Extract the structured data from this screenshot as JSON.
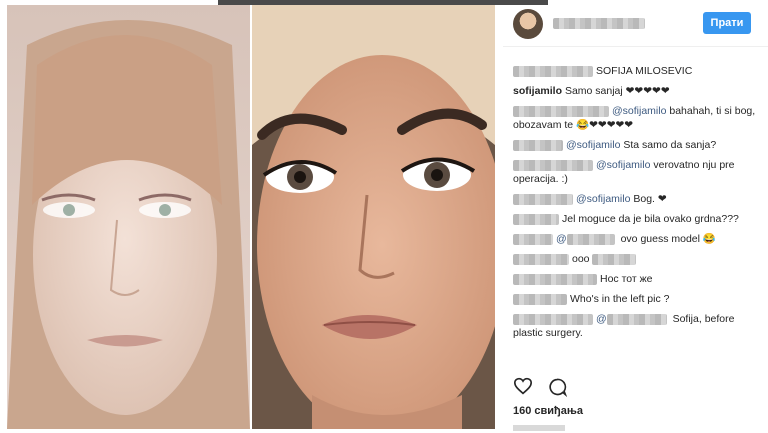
{
  "header": {
    "follow_label": "Прати"
  },
  "comments": [
    {
      "text": "SOFIJA MILOSEVIC"
    },
    {
      "user": "sofijamilo",
      "text": "Samo sanjaj ❤❤❤❤❤"
    },
    {
      "mention": "@sofijamilo",
      "text": "bahahah, ti si bog, obozavam te 😂❤❤❤❤❤"
    },
    {
      "mention": "@sofijamilo",
      "text": "Sta samo da sanja?"
    },
    {
      "mention": "@sofijamilo",
      "text": "verovatno nju pre operacija. :)"
    },
    {
      "mention": "@sofijamilo",
      "text": "Bog. ❤"
    },
    {
      "text": "Jel moguce da je bila ovako grdna???"
    },
    {
      "mention": "@",
      "text": "ovo guess model 😂"
    },
    {
      "text": "ооо"
    },
    {
      "text": "Нос тот же"
    },
    {
      "text": "Who's in the left pic ?"
    },
    {
      "mention": "@",
      "text": "Sofija, before plastic surgery."
    }
  ],
  "likes": "160 свиђања",
  "icons": [
    "heart-icon",
    "comment-icon"
  ]
}
